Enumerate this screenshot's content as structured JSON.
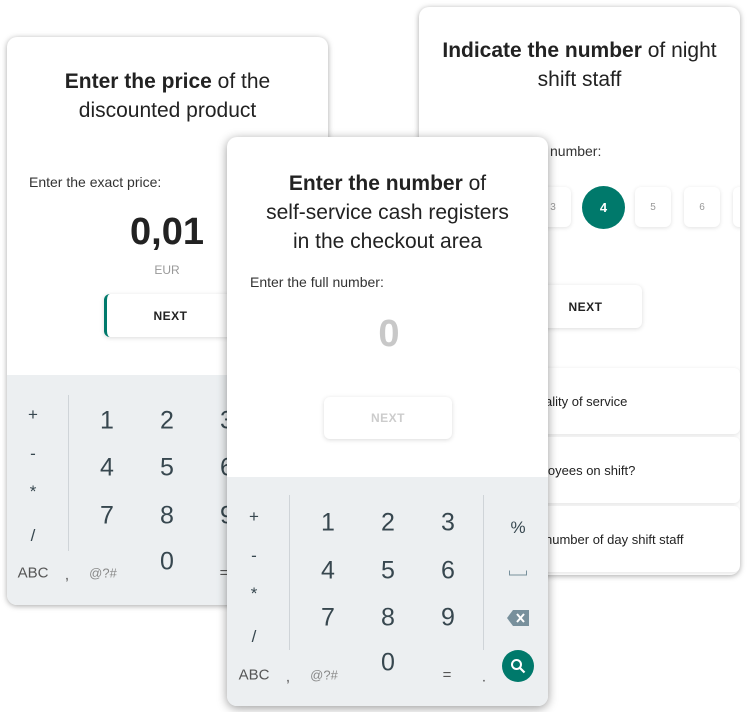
{
  "price_card": {
    "title_bold": "Enter the price",
    "title_rest": " of the",
    "title_line2": "discounted product",
    "label": "Enter the exact price:",
    "value": "0,01",
    "currency": "EUR",
    "next": "NEXT",
    "keypad": {
      "ops": [
        "+",
        "-",
        "*",
        "/"
      ],
      "digits": [
        "1",
        "2",
        "3",
        "4",
        "5",
        "6",
        "7",
        "8",
        "9",
        "0"
      ],
      "abc": "ABC",
      "comma": ",",
      "symbols": "@?#",
      "equals": "="
    }
  },
  "night_card": {
    "title_bold": "Indicate the number",
    "title_rest": " of night",
    "title_line2": "shift staff",
    "label": "number:",
    "options": [
      "3",
      "4",
      "5",
      "6"
    ],
    "selected": "4",
    "next": "NEXT",
    "items": [
      "ality of service",
      "loyees on shift?",
      "number of day shift staff"
    ]
  },
  "registers_card": {
    "title_bold": "Enter the number",
    "title_rest": " of",
    "title_line2": "self-service cash registers",
    "title_line3": "in the checkout area",
    "label": "Enter the full number:",
    "value": "0",
    "next": "NEXT",
    "keypad": {
      "ops": [
        "+",
        "-",
        "*",
        "/"
      ],
      "digits": [
        "1",
        "2",
        "3",
        "4",
        "5",
        "6",
        "7",
        "8",
        "9",
        "0"
      ],
      "percent": "%",
      "abc": "ABC",
      "comma": ",",
      "symbols": "@?#",
      "equals": "=",
      "dot": "."
    }
  },
  "colors": {
    "accent": "#00796b",
    "keypad_bg": "#eceff1"
  }
}
